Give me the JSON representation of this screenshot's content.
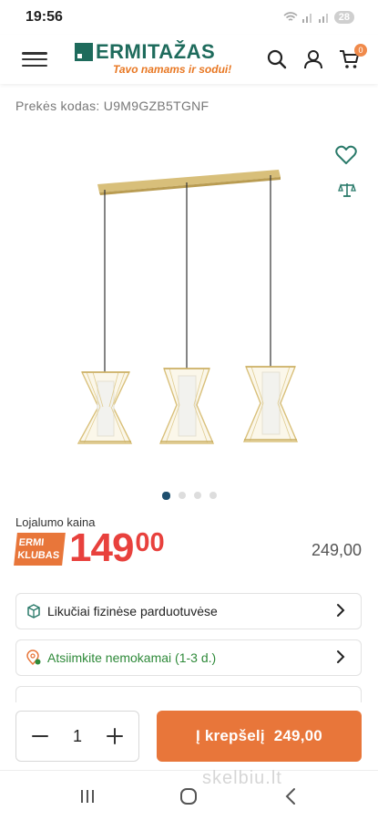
{
  "status_bar": {
    "time": "19:56",
    "battery": "28"
  },
  "header": {
    "logo_text": "ERMITAŽAS",
    "logo_tagline": "Tavo namams ir sodui!",
    "cart_count": "0"
  },
  "product": {
    "code_label": "Prekės kodas: U9M9GZB5TGNF",
    "image_count": 4,
    "active_image": 1
  },
  "pricing": {
    "loyalty_label": "Lojalumo kaina",
    "badge_line1": "ERMI",
    "badge_line2": "KLUBAS",
    "price_int": "149",
    "price_dec": "00",
    "old_price": "249,00"
  },
  "rows": {
    "stock": "Likučiai fizinėse parduotuvėse",
    "pickup": "Atsiimkite nemokamai (1-3 d.)"
  },
  "bottom": {
    "quantity": "1",
    "cart_label": "Į krepšelį",
    "cart_price": "249,00"
  },
  "watermark": "skelbiu.lt",
  "colors": {
    "brand_green": "#1e6b5c",
    "accent_orange": "#e8763a",
    "price_red": "#e8413d",
    "pickup_green": "#2f8a3a"
  }
}
